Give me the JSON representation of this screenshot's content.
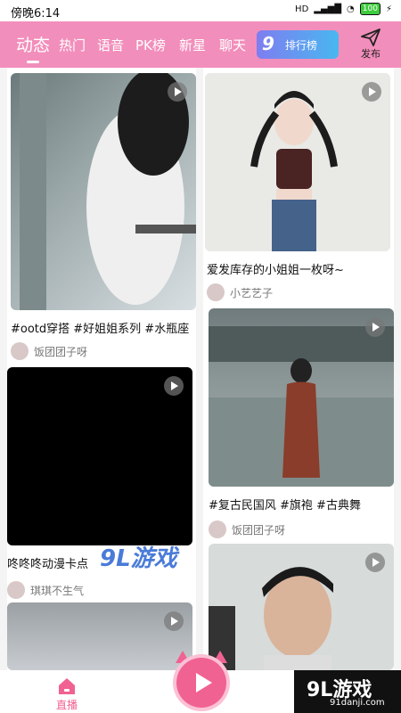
{
  "status": {
    "time": "傍晚6:14",
    "network": "HD",
    "battery": "100"
  },
  "tabs": [
    "动态",
    "热门",
    "语音",
    "PK榜",
    "新星",
    "聊天"
  ],
  "rank_badge": {
    "big": "9",
    "small": "排行榜"
  },
  "publish_label": "发布",
  "posts": [
    {
      "caption": "#ootd穿搭 #好姐姐系列 #水瓶座",
      "author": "饭团团子呀"
    },
    {
      "caption": "爱发库存的小姐姐一枚呀~",
      "author": "小艺艺子"
    },
    {
      "caption": "#复古民国风 #旗袍 #古典舞",
      "author": "饭团团子呀"
    },
    {
      "caption": "咚咚咚动漫卡点",
      "author": "琪琪不生气"
    }
  ],
  "bottom_nav": {
    "home_label": "直播"
  },
  "watermark": {
    "title": "9L游戏",
    "site": "91danji.com"
  },
  "colors": {
    "header": "#f28ebb",
    "accent": "#f06292"
  }
}
